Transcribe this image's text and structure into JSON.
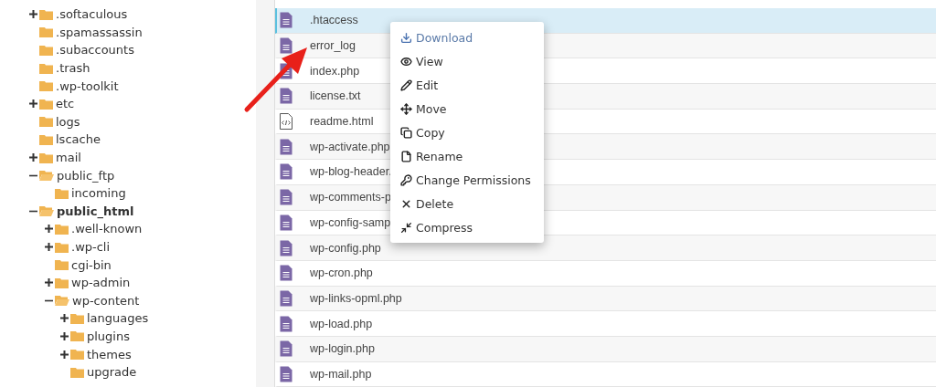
{
  "folder_tree": [
    {
      "name": ".softaculous",
      "kind": "branch",
      "expanded": false,
      "selected": false
    },
    {
      "name": ".spamassassin",
      "kind": "leaf",
      "selected": false
    },
    {
      "name": ".subaccounts",
      "kind": "leaf",
      "selected": false
    },
    {
      "name": ".trash",
      "kind": "leaf",
      "selected": false
    },
    {
      "name": ".wp-toolkit",
      "kind": "leaf",
      "selected": false
    },
    {
      "name": "etc",
      "kind": "branch",
      "expanded": false,
      "selected": false
    },
    {
      "name": "logs",
      "kind": "leaf",
      "selected": false
    },
    {
      "name": "lscache",
      "kind": "leaf",
      "selected": false
    },
    {
      "name": "mail",
      "kind": "branch",
      "expanded": false,
      "selected": false
    },
    {
      "name": "public_ftp",
      "kind": "branch",
      "expanded": true,
      "selected": false,
      "children": [
        {
          "name": "incoming",
          "kind": "leaf",
          "selected": false
        }
      ]
    },
    {
      "name": "public_html",
      "kind": "branch",
      "expanded": true,
      "selected": true,
      "children": [
        {
          "name": ".well-known",
          "kind": "branch",
          "expanded": false,
          "selected": false
        },
        {
          "name": ".wp-cli",
          "kind": "branch",
          "expanded": false,
          "selected": false
        },
        {
          "name": "cgi-bin",
          "kind": "leaf",
          "selected": false
        },
        {
          "name": "wp-admin",
          "kind": "branch",
          "expanded": false,
          "selected": false
        },
        {
          "name": "wp-content",
          "kind": "branch",
          "expanded": true,
          "selected": false,
          "children": [
            {
              "name": "languages",
              "kind": "branch",
              "expanded": false,
              "selected": false
            },
            {
              "name": "plugins",
              "kind": "branch",
              "expanded": false,
              "selected": false
            },
            {
              "name": "themes",
              "kind": "branch",
              "expanded": false,
              "selected": false
            },
            {
              "name": "upgrade",
              "kind": "leaf",
              "selected": false
            }
          ]
        }
      ]
    }
  ],
  "files": [
    {
      "name": ".htaccess",
      "kind": "text",
      "selected": true
    },
    {
      "name": "error_log",
      "kind": "text",
      "selected": false
    },
    {
      "name": "index.php",
      "kind": "text",
      "selected": false
    },
    {
      "name": "license.txt",
      "kind": "text",
      "selected": false
    },
    {
      "name": "readme.html",
      "kind": "html",
      "selected": false
    },
    {
      "name": "wp-activate.php",
      "kind": "text",
      "selected": false
    },
    {
      "name": "wp-blog-header.",
      "kind": "text",
      "selected": false
    },
    {
      "name": "wp-comments-p",
      "kind": "text",
      "selected": false
    },
    {
      "name": "wp-config-samp",
      "kind": "text",
      "selected": false
    },
    {
      "name": "wp-config.php",
      "kind": "text",
      "selected": false
    },
    {
      "name": "wp-cron.php",
      "kind": "text",
      "selected": false
    },
    {
      "name": "wp-links-opml.php",
      "kind": "text",
      "selected": false
    },
    {
      "name": "wp-load.php",
      "kind": "text",
      "selected": false
    },
    {
      "name": "wp-login.php",
      "kind": "text",
      "selected": false
    },
    {
      "name": "wp-mail.php",
      "kind": "text",
      "selected": false
    }
  ],
  "context_menu": [
    {
      "label": "Download",
      "highlighted": true
    },
    {
      "label": "View",
      "highlighted": false
    },
    {
      "label": "Edit",
      "highlighted": false
    },
    {
      "label": "Move",
      "highlighted": false
    },
    {
      "label": "Copy",
      "highlighted": false
    },
    {
      "label": "Rename",
      "highlighted": false
    },
    {
      "label": "Change Permissions",
      "highlighted": false
    },
    {
      "label": "Delete",
      "highlighted": false
    },
    {
      "label": "Compress",
      "highlighted": false
    }
  ]
}
